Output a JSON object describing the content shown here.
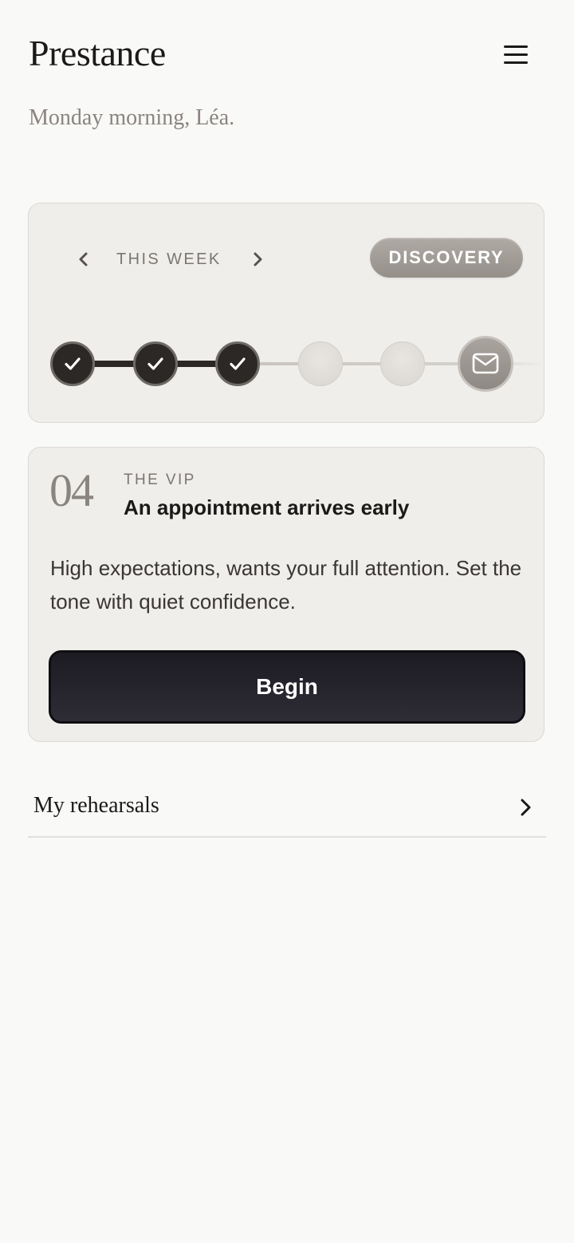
{
  "app": {
    "brand": "Prestance",
    "greeting": "Monday morning, Léa."
  },
  "header": {
    "menu_icon": "hamburger-menu-icon"
  },
  "week": {
    "label": "THIS WEEK",
    "prev_icon": "chevron-left-icon",
    "next_icon": "chevron-right-icon",
    "level": "DISCOVERY",
    "steps": [
      {
        "status": "completed",
        "icon": "check-icon"
      },
      {
        "status": "completed",
        "icon": "check-icon"
      },
      {
        "status": "completed",
        "icon": "check-icon"
      },
      {
        "status": "upcoming"
      },
      {
        "status": "upcoming"
      },
      {
        "status": "final",
        "icon": "envelope-icon"
      }
    ],
    "completed_count": 3,
    "total_steps": 6
  },
  "scenario": {
    "number": "04",
    "kicker": "THE VIP",
    "title": "An appointment arrives early",
    "description": "High expectations, wants your full attention. Set the tone with quiet confidence.",
    "cta": "Begin"
  },
  "links": {
    "rehearsals": "My rehearsals",
    "rehearsals_icon": "chevron-right-icon"
  },
  "colors": {
    "background": "#f9f9f7",
    "card": "#efeeeb",
    "accent_dark": "#2b2826",
    "pill": "#a39d98",
    "button": "#24232b"
  }
}
